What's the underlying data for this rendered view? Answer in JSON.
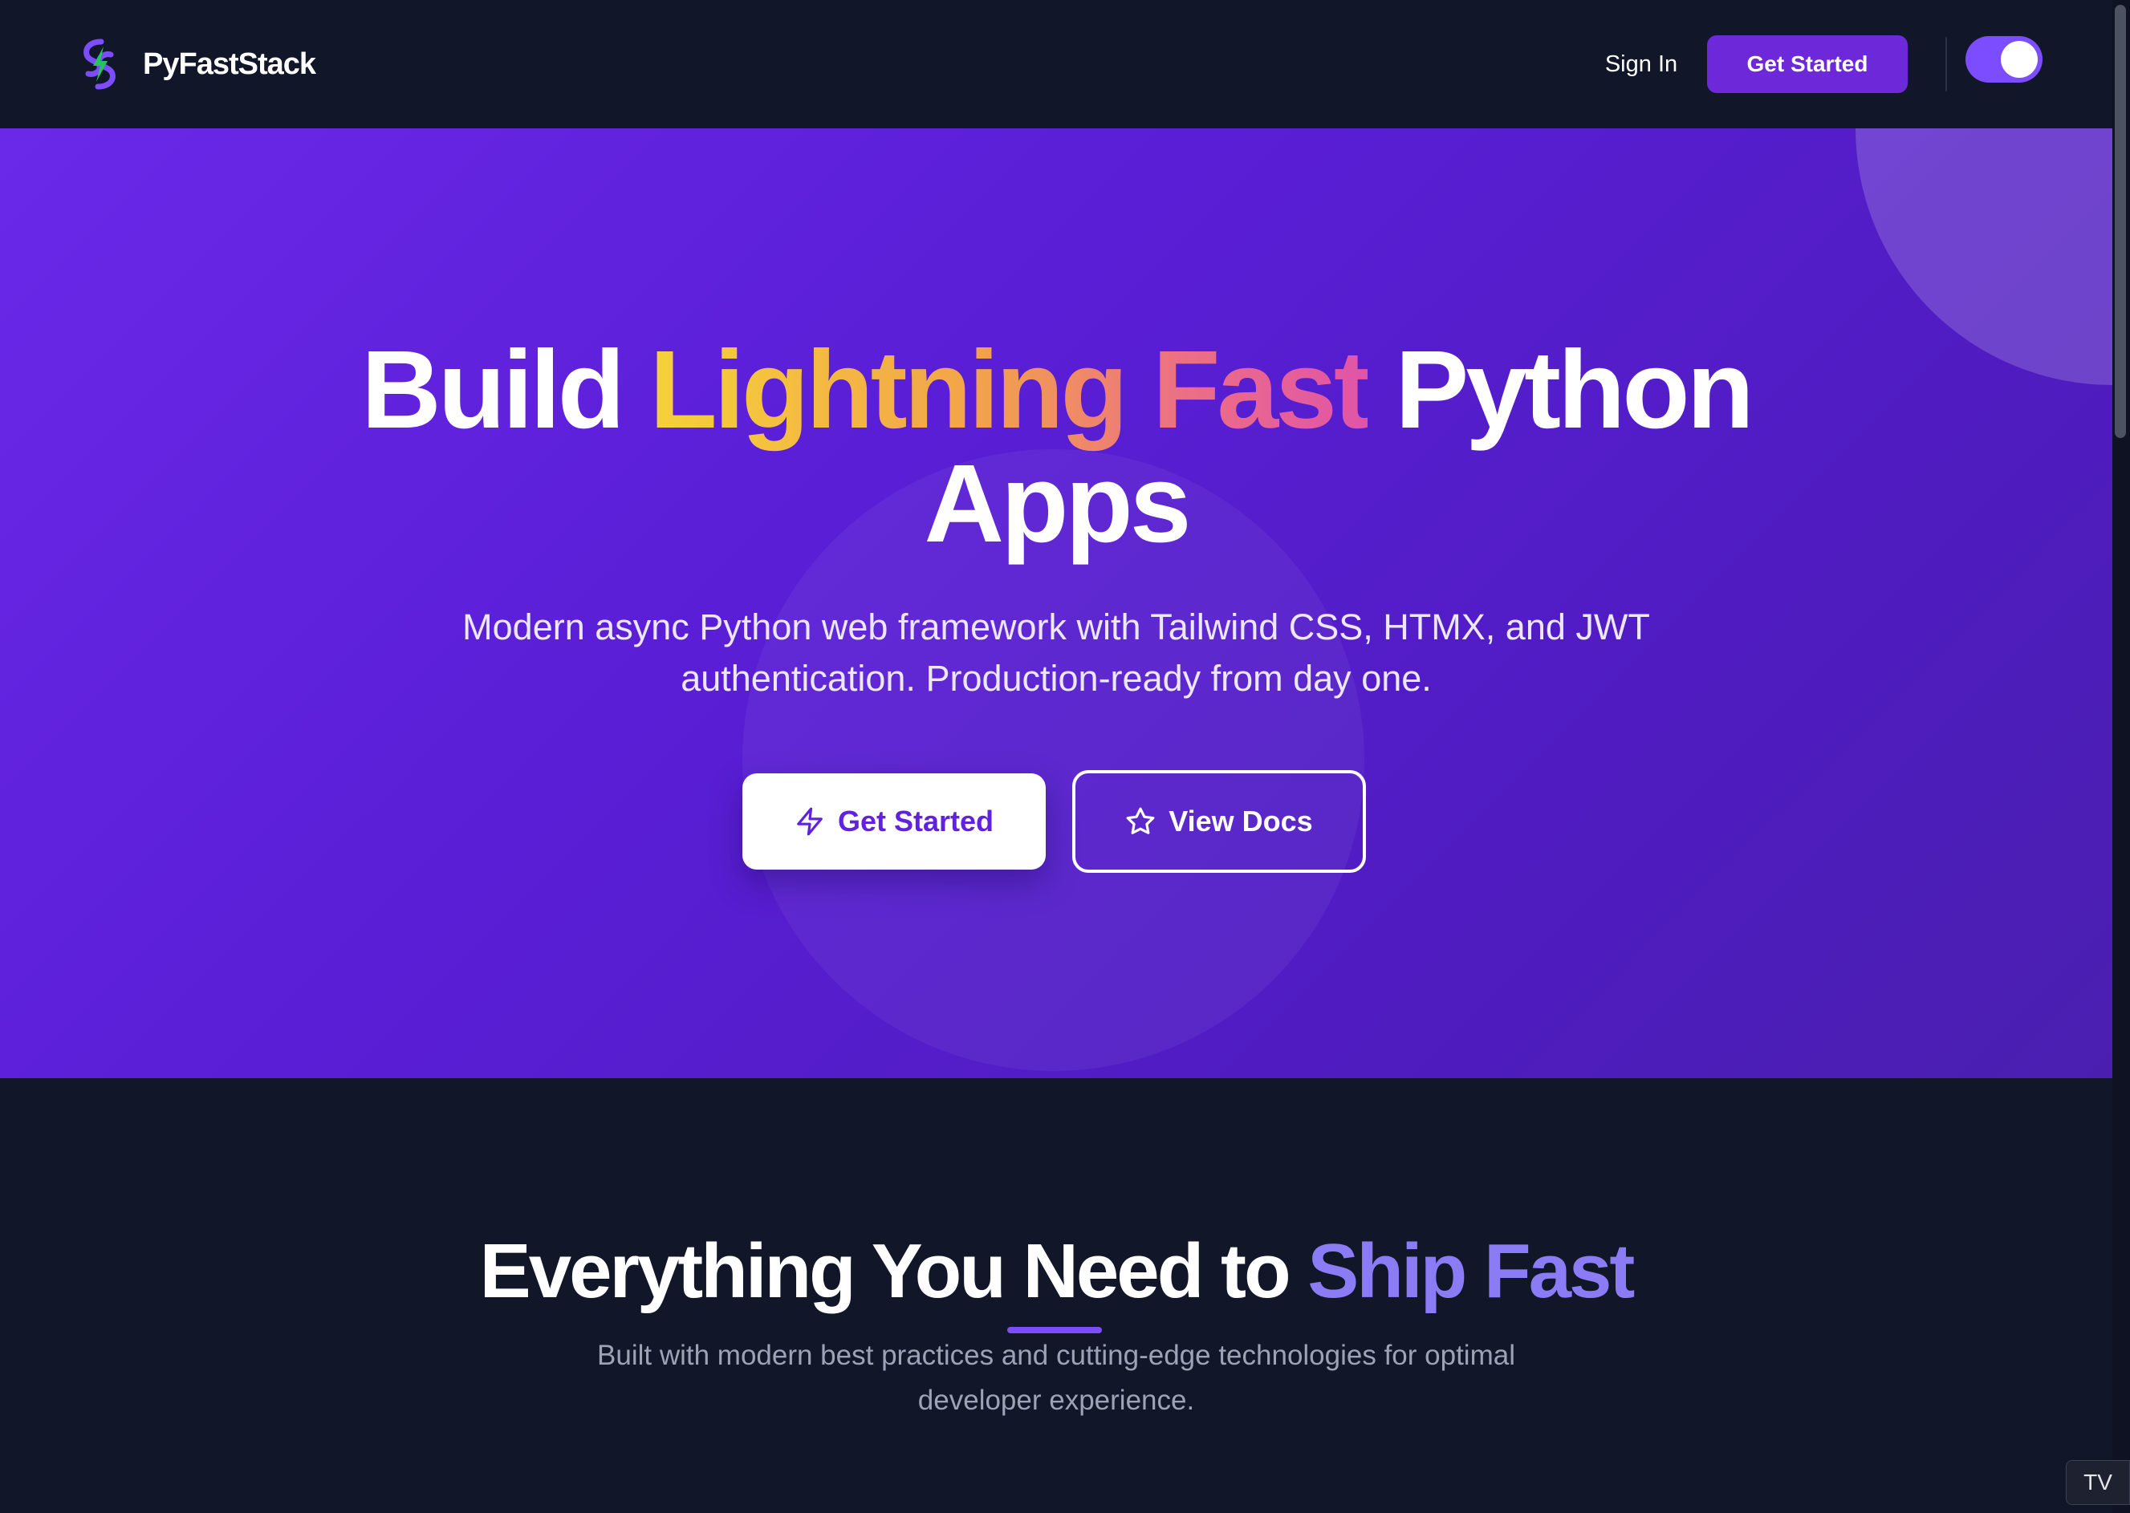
{
  "navbar": {
    "brand_name": "PyFastStack",
    "sign_in_label": "Sign In",
    "get_started_label": "Get Started",
    "theme_toggle_on": true
  },
  "hero": {
    "title_part1": "Build ",
    "title_highlight": "Lightning Fast",
    "title_part2": " Python",
    "title_line2": "Apps",
    "subtitle": "Modern async Python web framework with Tailwind CSS, HTMX, and JWT authentication. Production-ready from day one.",
    "primary_button_label": "Get Started",
    "primary_button_icon": "lightning-icon",
    "secondary_button_label": "View Docs",
    "secondary_button_icon": "star-icon"
  },
  "features": {
    "title_part1": "Everything You Need to ",
    "title_accent": "Ship Fast",
    "subtitle": "Built with modern best practices and cutting-edge technologies for optimal developer experience."
  },
  "widget": {
    "label": "TV"
  },
  "colors": {
    "nav_background": "#111629",
    "primary_purple": "#6d28d9",
    "hero_gradient_start": "#6a28e8",
    "hero_gradient_end": "#4a1fb0",
    "accent_violet": "#8b7cf6",
    "highlight_gradient": [
      "#f5d23a",
      "#f2a449",
      "#ec6e86",
      "#e054a8"
    ]
  }
}
